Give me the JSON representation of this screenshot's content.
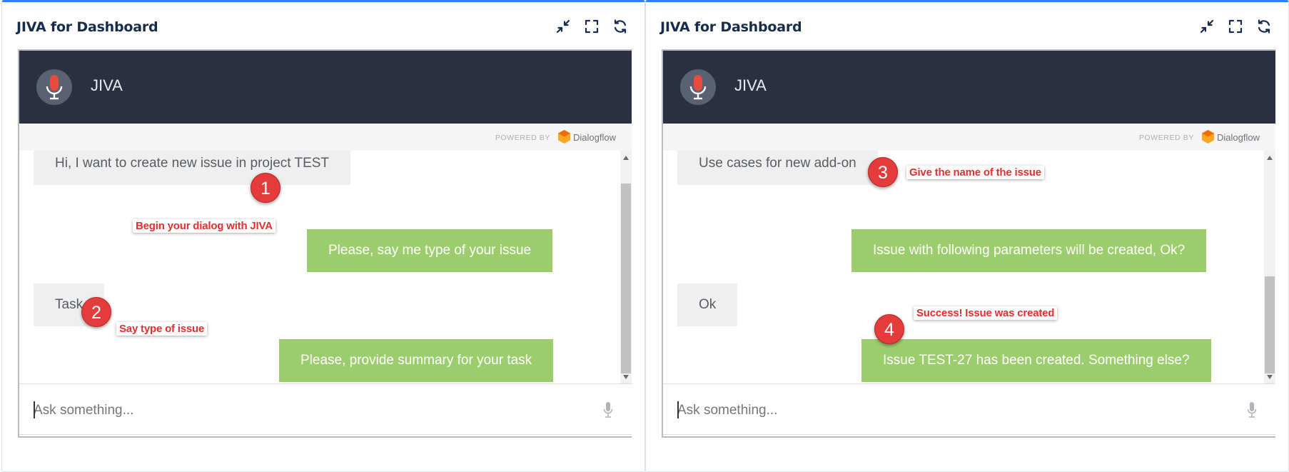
{
  "left": {
    "title": "JIVA for Dashboard",
    "agent_name": "JIVA",
    "powered_by": "POWERED BY",
    "powered_brand": "Dialogflow",
    "messages": [
      {
        "sender": "user",
        "text": "Hi, I want to create new issue in project TEST"
      },
      {
        "sender": "bot",
        "text": "Please, say me type of your issue"
      },
      {
        "sender": "user",
        "text": "Task"
      },
      {
        "sender": "bot",
        "text": "Please, provide summary for your task"
      }
    ],
    "input_placeholder": "Ask something...",
    "annotations": [
      {
        "number": "1",
        "text": "Begin your dialog with JIVA"
      },
      {
        "number": "2",
        "text": "Say type of issue"
      }
    ]
  },
  "right": {
    "title": "JIVA for Dashboard",
    "agent_name": "JIVA",
    "powered_by": "POWERED BY",
    "powered_brand": "Dialogflow",
    "messages": [
      {
        "sender": "user",
        "text": "Use cases for new add-on"
      },
      {
        "sender": "bot",
        "text": "Issue with following parameters will be created, Ok?"
      },
      {
        "sender": "user",
        "text": "Ok"
      },
      {
        "sender": "bot",
        "text": "Issue TEST-27 has been created. Something else?"
      }
    ],
    "input_placeholder": "Ask something...",
    "annotations": [
      {
        "number": "3",
        "text": "Give the name of the issue"
      },
      {
        "number": "4",
        "text": "Success! Issue was created"
      }
    ]
  },
  "icons": {
    "minimize": "collapse-arrows-icon",
    "maximize": "fullscreen-corners-icon",
    "refresh": "refresh-arrows-icon",
    "avatar": "microphone-icon",
    "input_mic": "microphone-icon",
    "brand": "dialogflow-logo-icon"
  },
  "colors": {
    "agent_header": "#2b3040",
    "bot_bubble": "#9ccd6d",
    "user_bubble": "#efefef",
    "annotation_marker": "#e43b3b",
    "annotation_text": "#e52e2e",
    "mic_red": "#e74c3c",
    "gadget_top_border": "#2684ff"
  }
}
